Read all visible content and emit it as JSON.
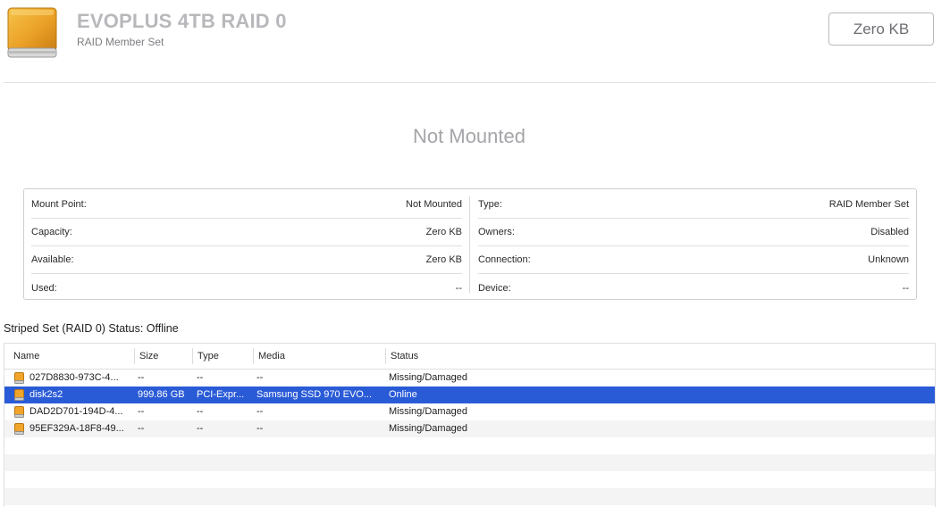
{
  "header": {
    "title": "EVOPLUS 4TB RAID 0",
    "subtitle": "RAID Member Set",
    "size": "Zero KB",
    "icon": "external-drive-icon"
  },
  "mount_status": "Not Mounted",
  "info": {
    "left": [
      {
        "label": "Mount Point:",
        "value": "Not Mounted"
      },
      {
        "label": "Capacity:",
        "value": "Zero KB"
      },
      {
        "label": "Available:",
        "value": "Zero KB"
      },
      {
        "label": "Used:",
        "value": "--"
      }
    ],
    "right": [
      {
        "label": "Type:",
        "value": "RAID Member Set"
      },
      {
        "label": "Owners:",
        "value": "Disabled"
      },
      {
        "label": "Connection:",
        "value": "Unknown"
      },
      {
        "label": "Device:",
        "value": "--"
      }
    ]
  },
  "raid_status": "Striped Set (RAID 0) Status: Offline",
  "table": {
    "columns": [
      "Name",
      "Size",
      "Type",
      "Media",
      "Status"
    ],
    "rows": [
      {
        "name": "027D8830-973C-4...",
        "size": "--",
        "type": "--",
        "media": "--",
        "status": "Missing/Damaged"
      },
      {
        "name": "disk2s2",
        "size": "999.86 GB",
        "type": "PCI-Expr...",
        "media": "Samsung SSD 970 EVO...",
        "status": "Online"
      },
      {
        "name": "DAD2D701-194D-4...",
        "size": "--",
        "type": "--",
        "media": "--",
        "status": "Missing/Damaged"
      },
      {
        "name": "95EF329A-18F8-49...",
        "size": "--",
        "type": "--",
        "media": "--",
        "status": "Missing/Damaged"
      }
    ]
  },
  "colors": {
    "selection": "#2a5bd7",
    "drive_orange": "#f0a52a"
  }
}
